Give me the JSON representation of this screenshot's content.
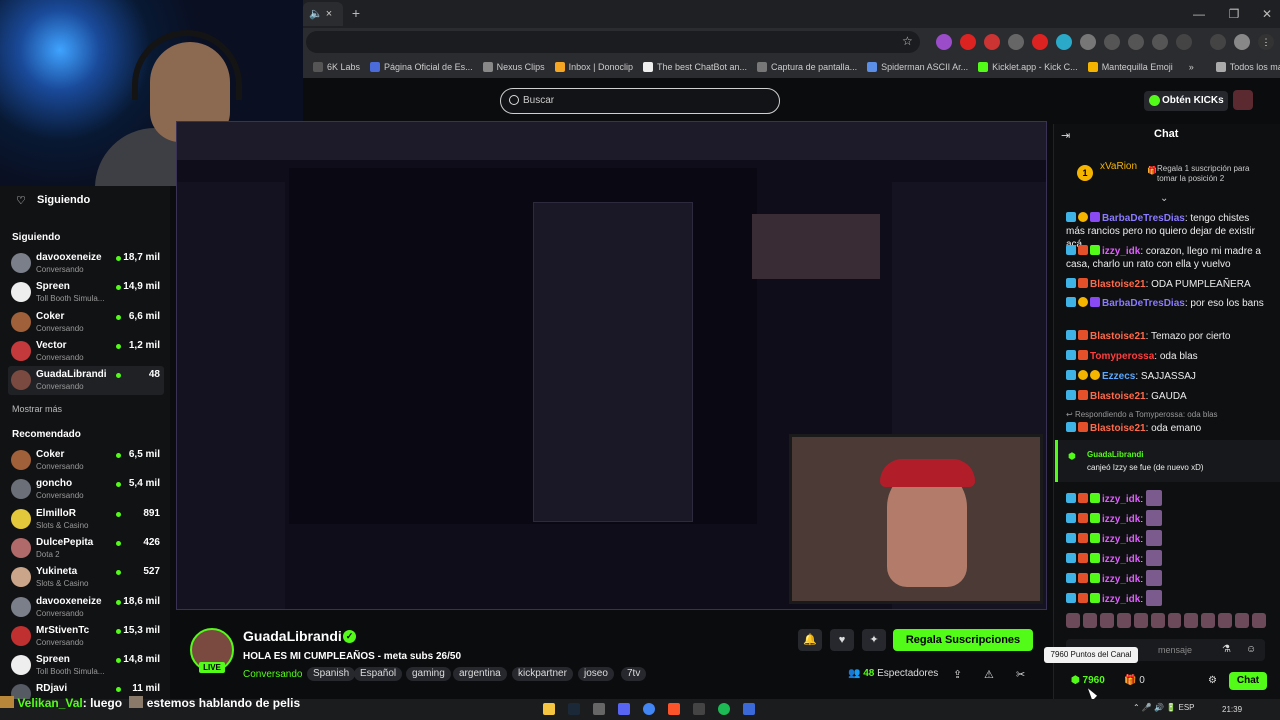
{
  "browser": {
    "tab_close": "×",
    "new_tab": "+",
    "window_buttons": [
      "—",
      "❐",
      "✕"
    ],
    "bookmarks": [
      "6K Labs",
      "Página Oficial de Es...",
      "Nexus Clips",
      "Inbox | Donoclip",
      "The best ChatBot an...",
      "Captura de pantalla...",
      "Spiderman ASCII Ar...",
      "Kicklet.app - Kick C...",
      "Mantequilla Emoji"
    ],
    "bookmarks_more": "»",
    "all_bookmarks": "Todos los marcadores"
  },
  "header": {
    "search_placeholder": "Buscar",
    "get_kicks": "Obtén KICKs"
  },
  "sidebar": {
    "following_label": "Siguiendo",
    "following_title": "Siguiendo",
    "following": [
      {
        "name": "davooxeneize",
        "sub": "Conversando",
        "count": "18,7 mil",
        "color": "#7a7f8a"
      },
      {
        "name": "Spreen",
        "sub": "Toll Booth Simula...",
        "count": "14,9 mil",
        "color": "#eeeeee"
      },
      {
        "name": "Coker",
        "sub": "Conversando",
        "count": "6,6 mil",
        "color": "#a0603a"
      },
      {
        "name": "Vector",
        "sub": "Conversando",
        "count": "1,2 mil",
        "color": "#c4393b"
      },
      {
        "name": "GuadaLibrandi",
        "sub": "Conversando",
        "count": "48",
        "color": "#7a4a40"
      }
    ],
    "show_more": "Mostrar más",
    "recommended_title": "Recomendado",
    "recommended": [
      {
        "name": "Coker",
        "sub": "Conversando",
        "count": "6,5 mil",
        "color": "#a0603a"
      },
      {
        "name": "goncho",
        "sub": "Conversando",
        "count": "5,4 mil",
        "color": "#6b6f78"
      },
      {
        "name": "ElmilloR",
        "sub": "Slots & Casino",
        "count": "891",
        "color": "#e3c83b"
      },
      {
        "name": "DulcePepita",
        "sub": "Dota 2",
        "count": "426",
        "color": "#b06a6a"
      },
      {
        "name": "Yukineta",
        "sub": "Slots & Casino",
        "count": "527",
        "color": "#caa58a"
      },
      {
        "name": "davooxeneize",
        "sub": "Conversando",
        "count": "18,6 mil",
        "color": "#7a7f8a"
      },
      {
        "name": "MrStivenTc",
        "sub": "Conversando",
        "count": "15,3 mil",
        "color": "#c03030"
      },
      {
        "name": "Spreen",
        "sub": "Toll Booth Simula...",
        "count": "14,8 mil",
        "color": "#eeeeee"
      },
      {
        "name": "RDjavi",
        "sub": "",
        "count": "11 mil",
        "color": "#555a63"
      }
    ]
  },
  "stream": {
    "streamer": "GuadaLibrandi",
    "live": "LIVE",
    "title": "HOLA ES MI CUMPLEAÑOS - meta subs 26/50",
    "category": "Conversando",
    "tags": [
      "Spanish",
      "Español",
      "gaming",
      "argentina",
      "kickpartner",
      "joseo",
      "7tv"
    ],
    "gift_subs": "Regala Suscripciones",
    "viewers_count": "48",
    "viewers_label": "Espectadores"
  },
  "chat": {
    "title": "Chat",
    "leader_rank": "1",
    "leader_name": "xVaRion",
    "leader_info": "Regala 1 suscripción para tomar la posición 2",
    "messages": [
      {
        "user": "BarbaDeTresDias",
        "color": "#8a7bff",
        "text": ": tengo chistes más rancios pero no quiero dejar de existir acá",
        "badges": [
          "prime",
          "gold",
          "purple"
        ]
      },
      {
        "user": "izzy_idk",
        "color": "#e05dff",
        "text": ": corazon, llego mi madre a casa, charlo un rato con ella y vuelvo",
        "badges": [
          "prime",
          "red",
          "green"
        ]
      },
      {
        "user": "Blastoise21",
        "color": "#ff6a4a",
        "text": ": ODA PUMPLEAÑERA",
        "badges": [
          "prime",
          "red"
        ]
      },
      {
        "user": "BarbaDeTresDias",
        "color": "#8a7bff",
        "text": ": por eso los bans",
        "badges": [
          "prime",
          "gold",
          "purple"
        ]
      },
      {
        "user": "Blastoise21",
        "color": "#ff6a4a",
        "text": ": Temazo por cierto",
        "badges": [
          "prime",
          "red"
        ]
      },
      {
        "user": "Tomyperossa",
        "color": "#ff3d3d",
        "text": ": oda blas",
        "badges": [
          "prime",
          "red"
        ]
      },
      {
        "user": "Ezzecs",
        "color": "#5aa8ff",
        "text": ": SAJJASSAJ",
        "badges": [
          "prime",
          "gold",
          "gold"
        ]
      },
      {
        "user": "Blastoise21",
        "color": "#ff6a4a",
        "text": ": GAUDA",
        "badges": [
          "prime",
          "red"
        ]
      }
    ],
    "reply_line": "Respondiendo a Tomyperossa: oda blas",
    "reply_msg": {
      "user": "Blastoise21",
      "text": ": oda emano"
    },
    "redeem_name": "GuadaLibrandi",
    "redeem_text": "canjeó Izzy se fue (de nuevo xD)",
    "spam_user": "izzy_idk",
    "spam_sep": ":",
    "input_placeholder": "mensaje",
    "tooltip": "7960 Puntos del Canal",
    "points": "7960",
    "gifts": "0",
    "chat_button": "Chat"
  },
  "overlay": {
    "ticker_user": "Velikan_Val",
    "ticker_text": ": luego",
    "ticker_text2": "estemos hablando de pelis"
  },
  "taskbar": {
    "lang": "ESP",
    "time": "21:39"
  },
  "colors": {
    "kick_green": "#53fc18",
    "background": "#0b0c0e"
  }
}
